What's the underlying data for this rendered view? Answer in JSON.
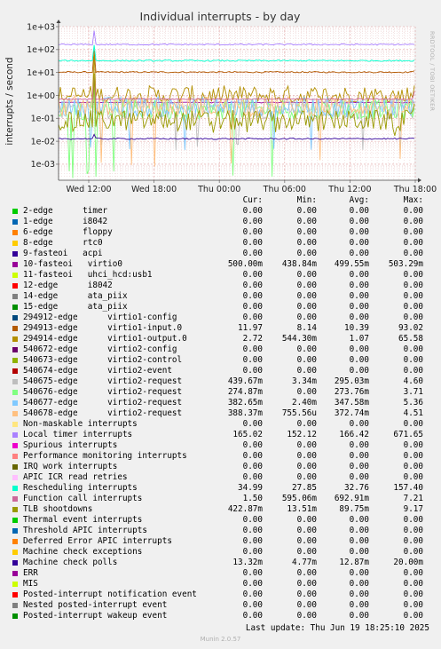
{
  "title": "Individual interrupts - by day",
  "watermark": "RRDTOOL / TOBI OETIKER",
  "legend_headers": [
    "Cur:",
    "Min:",
    "Avg:",
    "Max:"
  ],
  "last_update": "Last update: Thu Jun 19 18:25:10 2025",
  "version": "Munin 2.0.57",
  "chart_data": {
    "type": "line",
    "title": "Individual interrupts - by day",
    "ylabel": "interrupts / second",
    "y_scale": "log",
    "ylim": [
      0.0002,
      1000
    ],
    "y_ticks": [
      "1e-03",
      "1e-02",
      "1e-01",
      "1e+00",
      "1e+01",
      "1e+02",
      "1e+03"
    ],
    "x_ticks": [
      "Wed 12:00",
      "Wed 18:00",
      "Thu 00:00",
      "Thu 06:00",
      "Thu 12:00",
      "Thu 18:00"
    ],
    "grid": true,
    "series": [
      {
        "name": "2-edge      timer",
        "color": "#00cc00",
        "cur": "0.00",
        "min": "0.00",
        "avg": "0.00",
        "max": "0.00"
      },
      {
        "name": "1-edge      i8042",
        "color": "#0066b3",
        "cur": "0.00",
        "min": "0.00",
        "avg": "0.00",
        "max": "0.00"
      },
      {
        "name": "6-edge      floppy",
        "color": "#ff8000",
        "cur": "0.00",
        "min": "0.00",
        "avg": "0.00",
        "max": "0.00"
      },
      {
        "name": "8-edge      rtc0",
        "color": "#ffcc00",
        "cur": "0.00",
        "min": "0.00",
        "avg": "0.00",
        "max": "0.00"
      },
      {
        "name": "9-fasteoi   acpi",
        "color": "#330099",
        "cur": "0.00",
        "min": "0.00",
        "avg": "0.00",
        "max": "0.00"
      },
      {
        "name": "10-fasteoi   virtio0",
        "color": "#990099",
        "cur": "500.00m",
        "min": "438.84m",
        "avg": "499.55m",
        "max": "503.29m"
      },
      {
        "name": "11-fasteoi   uhci_hcd:usb1",
        "color": "#ccff00",
        "cur": "0.00",
        "min": "0.00",
        "avg": "0.00",
        "max": "0.00"
      },
      {
        "name": "12-edge      i8042",
        "color": "#ff0000",
        "cur": "0.00",
        "min": "0.00",
        "avg": "0.00",
        "max": "0.00"
      },
      {
        "name": "14-edge      ata_piix",
        "color": "#808080",
        "cur": "0.00",
        "min": "0.00",
        "avg": "0.00",
        "max": "0.00"
      },
      {
        "name": "15-edge      ata_piix",
        "color": "#008f00",
        "cur": "0.00",
        "min": "0.00",
        "avg": "0.00",
        "max": "0.00"
      },
      {
        "name": "294912-edge      virtio1-config",
        "color": "#00487d",
        "cur": "0.00",
        "min": "0.00",
        "avg": "0.00",
        "max": "0.00"
      },
      {
        "name": "294913-edge      virtio1-input.0",
        "color": "#b35a00",
        "cur": "11.97",
        "min": "8.14",
        "avg": "10.39",
        "max": "93.02"
      },
      {
        "name": "294914-edge      virtio1-output.0",
        "color": "#b38f00",
        "cur": "2.72",
        "min": "544.30m",
        "avg": "1.07",
        "max": "65.58"
      },
      {
        "name": "540672-edge      virtio2-config",
        "color": "#6b006b",
        "cur": "0.00",
        "min": "0.00",
        "avg": "0.00",
        "max": "0.00"
      },
      {
        "name": "540673-edge      virtio2-control",
        "color": "#8fb300",
        "cur": "0.00",
        "min": "0.00",
        "avg": "0.00",
        "max": "0.00"
      },
      {
        "name": "540674-edge      virtio2-event",
        "color": "#b30000",
        "cur": "0.00",
        "min": "0.00",
        "avg": "0.00",
        "max": "0.00"
      },
      {
        "name": "540675-edge      virtio2-request",
        "color": "#bebebe",
        "cur": "439.67m",
        "min": "3.34m",
        "avg": "295.03m",
        "max": "4.60"
      },
      {
        "name": "540676-edge      virtio2-request",
        "color": "#80ff80",
        "cur": "274.87m",
        "min": "0.00",
        "avg": "273.76m",
        "max": "3.71"
      },
      {
        "name": "540677-edge      virtio2-request",
        "color": "#80c9ff",
        "cur": "382.65m",
        "min": "2.40m",
        "avg": "347.58m",
        "max": "5.36"
      },
      {
        "name": "540678-edge      virtio2-request",
        "color": "#ffc080",
        "cur": "388.37m",
        "min": "755.56u",
        "avg": "372.74m",
        "max": "4.51"
      },
      {
        "name": "Non-maskable interrupts",
        "color": "#ffe680",
        "cur": "0.00",
        "min": "0.00",
        "avg": "0.00",
        "max": "0.00"
      },
      {
        "name": "Local timer interrupts",
        "color": "#aa80ff",
        "cur": "165.02",
        "min": "152.12",
        "avg": "166.42",
        "max": "671.65"
      },
      {
        "name": "Spurious interrupts",
        "color": "#ee00cc",
        "cur": "0.00",
        "min": "0.00",
        "avg": "0.00",
        "max": "0.00"
      },
      {
        "name": "Performance monitoring interrupts",
        "color": "#ff8080",
        "cur": "0.00",
        "min": "0.00",
        "avg": "0.00",
        "max": "0.00"
      },
      {
        "name": "IRQ work interrupts",
        "color": "#666600",
        "cur": "0.00",
        "min": "0.00",
        "avg": "0.00",
        "max": "0.00"
      },
      {
        "name": "APIC ICR read retries",
        "color": "#ffbfff",
        "cur": "0.00",
        "min": "0.00",
        "avg": "0.00",
        "max": "0.00"
      },
      {
        "name": "Rescheduling interrupts",
        "color": "#00ffcc",
        "cur": "34.99",
        "min": "27.85",
        "avg": "32.76",
        "max": "157.40"
      },
      {
        "name": "Function call interrupts",
        "color": "#cc6699",
        "cur": "1.50",
        "min": "595.06m",
        "avg": "692.91m",
        "max": "7.21"
      },
      {
        "name": "TLB shootdowns",
        "color": "#999900",
        "cur": "422.87m",
        "min": "13.51m",
        "avg": "89.75m",
        "max": "9.17"
      },
      {
        "name": "Thermal event interrupts",
        "color": "#00cc00",
        "cur": "0.00",
        "min": "0.00",
        "avg": "0.00",
        "max": "0.00"
      },
      {
        "name": "Threshold APIC interrupts",
        "color": "#0066b3",
        "cur": "0.00",
        "min": "0.00",
        "avg": "0.00",
        "max": "0.00"
      },
      {
        "name": "Deferred Error APIC interrupts",
        "color": "#ff8000",
        "cur": "0.00",
        "min": "0.00",
        "avg": "0.00",
        "max": "0.00"
      },
      {
        "name": "Machine check exceptions",
        "color": "#ffcc00",
        "cur": "0.00",
        "min": "0.00",
        "avg": "0.00",
        "max": "0.00"
      },
      {
        "name": "Machine check polls",
        "color": "#330099",
        "cur": "13.32m",
        "min": "4.77m",
        "avg": "12.87m",
        "max": "20.00m"
      },
      {
        "name": "ERR",
        "color": "#990099",
        "cur": "0.00",
        "min": "0.00",
        "avg": "0.00",
        "max": "0.00"
      },
      {
        "name": "MIS",
        "color": "#ccff00",
        "cur": "0.00",
        "min": "0.00",
        "avg": "0.00",
        "max": "0.00"
      },
      {
        "name": "Posted-interrupt notification event",
        "color": "#ff0000",
        "cur": "0.00",
        "min": "0.00",
        "avg": "0.00",
        "max": "0.00"
      },
      {
        "name": "Nested posted-interrupt event",
        "color": "#808080",
        "cur": "0.00",
        "min": "0.00",
        "avg": "0.00",
        "max": "0.00"
      },
      {
        "name": "Posted-interrupt wakeup event",
        "color": "#008f00",
        "cur": "0.00",
        "min": "0.00",
        "avg": "0.00",
        "max": "0.00"
      }
    ]
  }
}
